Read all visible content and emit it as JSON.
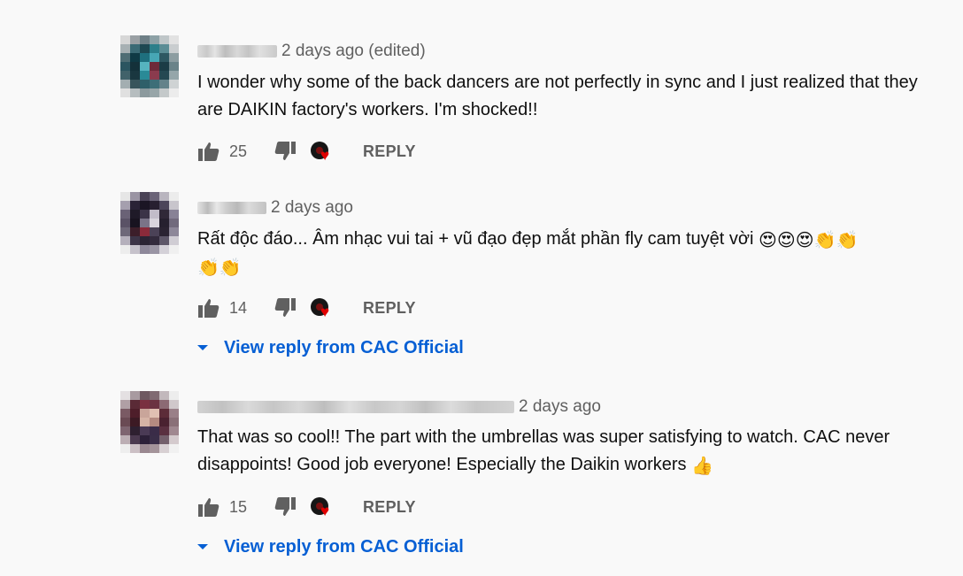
{
  "comments": [
    {
      "date": "2 days ago (edited)",
      "text": "I wonder why some of the back dancers are not perfectly in sync and I just realized that they are DAIKIN factory's workers. I'm shocked!!",
      "likes": "25",
      "reply_label": "REPLY"
    },
    {
      "date": "2 days ago",
      "text": "Rất độc đáo... Âm nhạc vui tai + vũ đạo đẹp mắt phần fly cam tuyệt vời",
      "emojis": [
        "😍",
        "😍",
        "😍",
        "👏",
        "👏",
        "👏",
        "👏"
      ],
      "likes": "14",
      "reply_label": "REPLY",
      "view_reply": "View reply from CAC Official"
    },
    {
      "date": "2 days ago",
      "text": "That was so cool!! The part with the umbrellas was super satisfying to watch. CAC never disappoints! Good job everyone! Especially the Daikin workers",
      "emojis": [
        "👍"
      ],
      "likes": "15",
      "reply_label": "REPLY",
      "view_reply": "View reply from CAC Official"
    }
  ],
  "icons": {
    "like": "thumbs-up-icon",
    "dislike": "thumbs-down-icon",
    "creator_heart": "creator-heart-icon",
    "expand": "caret-down-icon"
  },
  "colors": {
    "link_blue": "#065fd4",
    "meta_gray": "#606060",
    "heart_red": "#e00000",
    "background": "#f9f9f9"
  }
}
